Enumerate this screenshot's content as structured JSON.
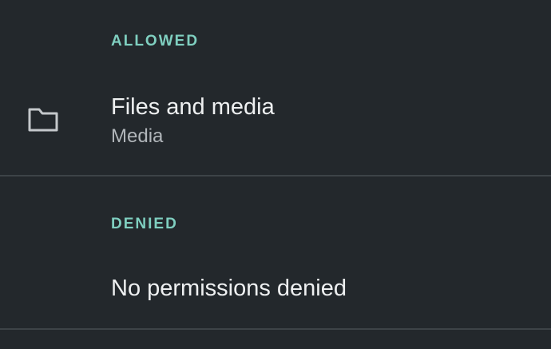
{
  "allowed": {
    "header": "ALLOWED",
    "items": [
      {
        "icon": "folder-icon",
        "title": "Files and media",
        "subtitle": "Media"
      }
    ]
  },
  "denied": {
    "header": "DENIED",
    "empty_text": "No permissions denied"
  },
  "colors": {
    "background": "#23282c",
    "accent": "#7fcfc0",
    "divider": "#3d4347",
    "primary_text": "#eef0f1",
    "secondary_text": "#b1b6ba"
  }
}
